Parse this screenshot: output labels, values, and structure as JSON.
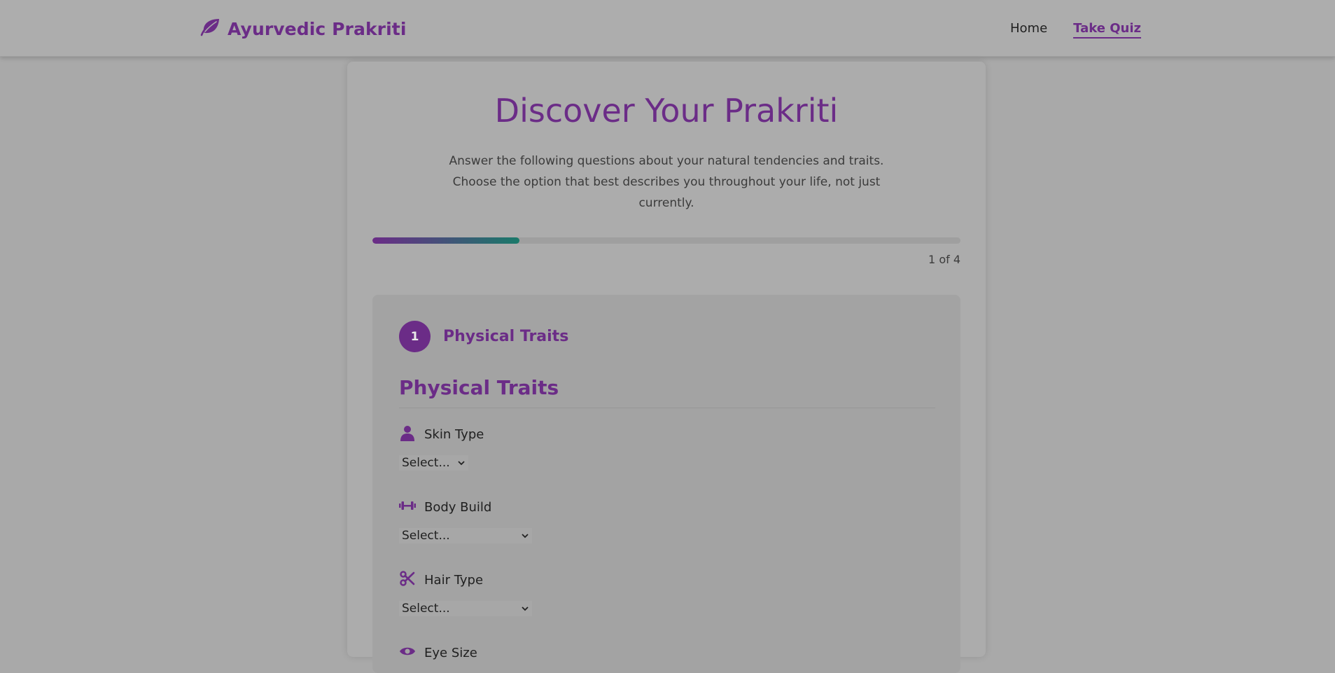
{
  "header": {
    "brand": "Ayurvedic Prakriti",
    "nav": [
      {
        "label": "Home",
        "active": false
      },
      {
        "label": "Take Quiz",
        "active": true
      }
    ]
  },
  "quiz": {
    "title": "Discover Your Prakriti",
    "intro": "Answer the following questions about your natural tendencies and traits. Choose the option that best describes you throughout your life, not just currently.",
    "progress": {
      "current": 1,
      "total": 4,
      "text": "1 of 4",
      "fraction": 0.25
    }
  },
  "section": {
    "step_number": "1",
    "step_label": "Physical Traits",
    "title": "Physical Traits",
    "fields": [
      {
        "label": "Skin Type",
        "icon": "person-icon",
        "value": "Select..."
      },
      {
        "label": "Body Build",
        "icon": "dumbbell-icon",
        "value": "Select..."
      },
      {
        "label": "Hair Type",
        "icon": "scissors-icon",
        "value": "Select..."
      },
      {
        "label": "Eye Size",
        "icon": "eye-icon",
        "value": ""
      }
    ]
  },
  "colors": {
    "accent": "#6b2c87",
    "progress_end": "#1a7a6a"
  }
}
